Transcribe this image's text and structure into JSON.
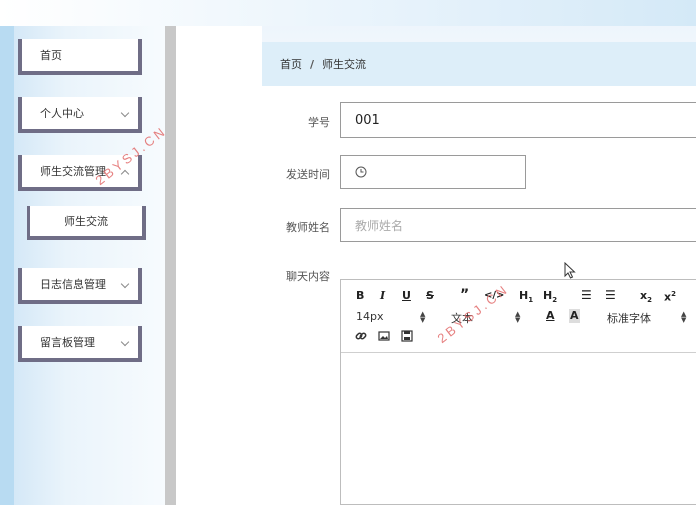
{
  "sidebar": {
    "items": [
      {
        "label": "首页"
      },
      {
        "label": "个人中心"
      },
      {
        "label": "师生交流管理"
      },
      {
        "label": "日志信息管理"
      },
      {
        "label": "留言板管理"
      }
    ],
    "subitem": {
      "label": "师生交流"
    }
  },
  "breadcrumb": {
    "home": "首页",
    "separator": "/",
    "current": "师生交流"
  },
  "form": {
    "student_id": {
      "label": "学号",
      "value": "001"
    },
    "send_time": {
      "label": "发送时间",
      "value": ""
    },
    "teacher_name": {
      "label": "教师姓名",
      "placeholder": "教师姓名"
    },
    "chat_content": {
      "label": "聊天内容"
    }
  },
  "editor": {
    "font_size": "14px",
    "paragraph": "文本",
    "font_family": "标准字体"
  },
  "watermark": "2BYSJ.CN"
}
